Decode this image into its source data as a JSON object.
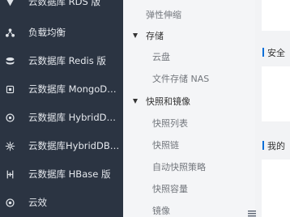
{
  "sidebar": {
    "items": [
      {
        "label": "云数据库 RDS 版",
        "icon": "rds-icon"
      },
      {
        "label": "负载均衡",
        "icon": "load-balancer-icon"
      },
      {
        "label": "云数据库 Redis 版",
        "icon": "redis-icon"
      },
      {
        "label": "云数据库 MongoDB 版",
        "icon": "mongodb-icon"
      },
      {
        "label": "云数据库 HybridDB fo...",
        "icon": "hybriddb-icon"
      },
      {
        "label": "云数据库HybridDB for...",
        "icon": "hybriddb-star-icon"
      },
      {
        "label": "云数据库 HBase 版",
        "icon": "hbase-icon"
      },
      {
        "label": "云效",
        "icon": "yunxiao-icon"
      }
    ]
  },
  "submenu": {
    "elastic": "弹性伸缩",
    "storage_group": "存储",
    "storage_items": [
      "云盘",
      "文件存储 NAS"
    ],
    "snapshot_group": "快照和镜像",
    "snapshot_items": [
      "快照列表",
      "快照链",
      "自动快照策略",
      "快照容量",
      "镜像"
    ]
  },
  "main": {
    "section1": "安全",
    "section2": "我的"
  },
  "colors": {
    "sidebar_bg": "#2b3442",
    "submenu_bg": "#f4f5f7",
    "accent": "#0b6fd8"
  }
}
